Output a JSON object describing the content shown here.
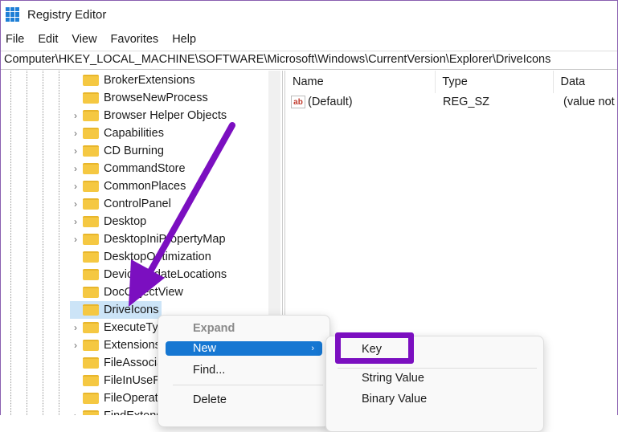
{
  "window": {
    "title": "Registry Editor",
    "icon": "registry-editor-icon"
  },
  "menu": [
    "File",
    "Edit",
    "View",
    "Favorites",
    "Help"
  ],
  "address": "Computer\\HKEY_LOCAL_MACHINE\\SOFTWARE\\Microsoft\\Windows\\CurrentVersion\\Explorer\\DriveIcons",
  "tree": [
    {
      "label": "BrokerExtensions",
      "expandable": false
    },
    {
      "label": "BrowseNewProcess",
      "expandable": false
    },
    {
      "label": "Browser Helper Objects",
      "expandable": true
    },
    {
      "label": "Capabilities",
      "expandable": true
    },
    {
      "label": "CD Burning",
      "expandable": true
    },
    {
      "label": "CommandStore",
      "expandable": true
    },
    {
      "label": "CommonPlaces",
      "expandable": true
    },
    {
      "label": "ControlPanel",
      "expandable": true
    },
    {
      "label": "Desktop",
      "expandable": true
    },
    {
      "label": "DesktopIniPropertyMap",
      "expandable": true
    },
    {
      "label": "DesktopOptimization",
      "expandable": false
    },
    {
      "label": "DeviceUpdateLocations",
      "expandable": false
    },
    {
      "label": "DocObjectView",
      "expandable": false
    },
    {
      "label": "DriveIcons",
      "expandable": false,
      "selected": true
    },
    {
      "label": "ExecuteTyp",
      "expandable": true
    },
    {
      "label": "Extensions",
      "expandable": true
    },
    {
      "label": "FileAssocia",
      "expandable": false
    },
    {
      "label": "FileInUseR",
      "expandable": false
    },
    {
      "label": "FileOperat",
      "expandable": false
    },
    {
      "label": "FindExtens",
      "expandable": true
    }
  ],
  "list": {
    "columns": [
      "Name",
      "Type",
      "Data"
    ],
    "rows": [
      {
        "name": "(Default)",
        "type": "REG_SZ",
        "data": "(value not"
      }
    ]
  },
  "context_menu": {
    "items": [
      "Expand",
      "New",
      "Find...",
      "Delete"
    ]
  },
  "submenu": {
    "items": [
      "Key",
      "String Value",
      "Binary Value"
    ]
  },
  "colors": {
    "highlight": "#1677d2",
    "annotation": "#7b0fc0"
  }
}
